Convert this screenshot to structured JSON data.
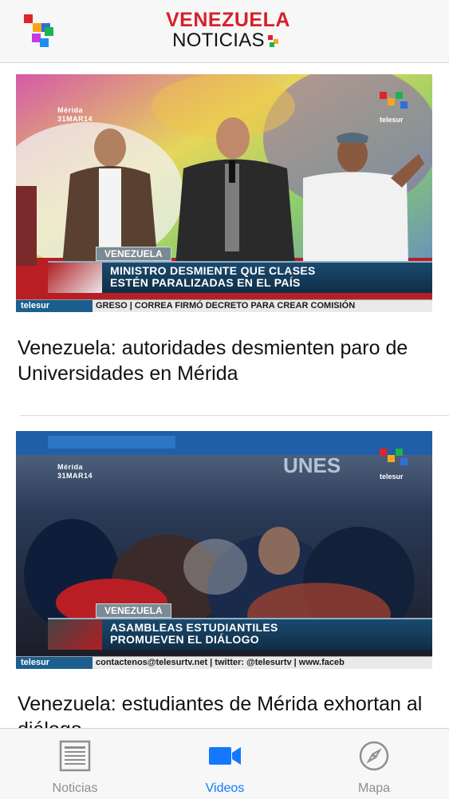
{
  "header": {
    "brand_line1": "VENEZUELA",
    "brand_line2": "NOTICIAS",
    "menu_icon": "pixel-logo-menu-icon"
  },
  "colors": {
    "brand_red": "#d6202a",
    "active_tab": "#1478ff",
    "inactive_tab": "#8e8e93",
    "telesur_blue": "#1c5f8f"
  },
  "feed": {
    "items": [
      {
        "title": "Venezuela: autoridades desmienten paro de Universidades en Mérida",
        "video": {
          "place": "Mérida",
          "date": "31MAR14",
          "tag": "VENEZUELA",
          "headline_line1": "MINISTRO DESMIENTE QUE CLASES",
          "headline_line2": "ESTÉN PARALIZADAS EN EL PAÍS",
          "ticker_brand": "telesur",
          "ticker_text": "GRESO | CORREA FIRMÓ DECRETO PARA CREAR COMISIÓN",
          "logo_text": "telesur"
        }
      },
      {
        "title": "Venezuela: estudiantes de Mérida exhortan al diálogo",
        "video": {
          "place": "Mérida",
          "date": "31MAR14",
          "tag": "VENEZUELA",
          "headline_line1": "ASAMBLEAS ESTUDIANTILES",
          "headline_line2": "PROMUEVEN EL DIÁLOGO",
          "ticker_brand": "telesur",
          "ticker_text": "contactenos@telesurtv.net | twitter: @telesurtv | www.faceb",
          "logo_text": "telesur",
          "wall_text": "UNES"
        }
      }
    ]
  },
  "tabbar": {
    "tabs": [
      {
        "label": "Noticias",
        "icon": "newspaper-icon",
        "active": false
      },
      {
        "label": "Videos",
        "icon": "video-camera-icon",
        "active": true
      },
      {
        "label": "Mapa",
        "icon": "compass-icon",
        "active": false
      }
    ]
  }
}
